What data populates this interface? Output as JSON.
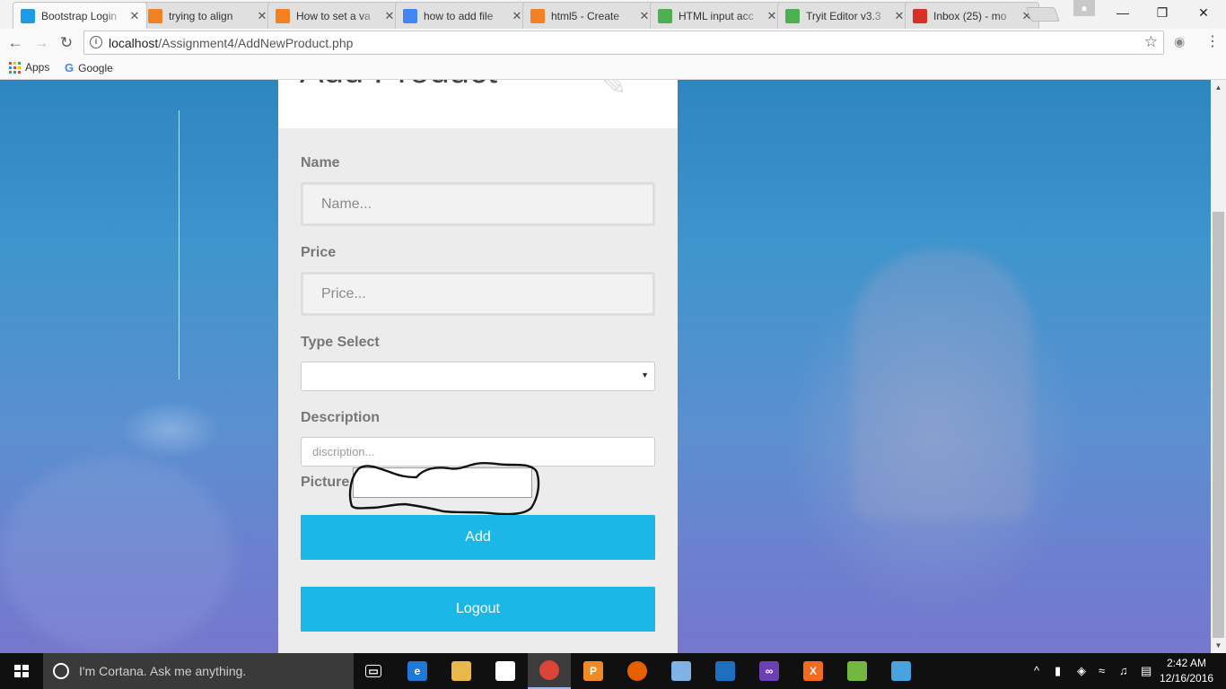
{
  "browser": {
    "tabs": [
      {
        "title": "Bootstrap Login",
        "icon": "bootstrap-login-favicon",
        "color": "#1e9be6",
        "active": true
      },
      {
        "title": "trying to align",
        "icon": "stackoverflow-favicon",
        "color": "#f48024",
        "active": false
      },
      {
        "title": "How to set a va",
        "icon": "stackoverflow-favicon",
        "color": "#f48024",
        "active": false
      },
      {
        "title": "how to add file",
        "icon": "google-favicon",
        "color": "#4285f4",
        "active": false
      },
      {
        "title": "html5 - Create",
        "icon": "stackoverflow-favicon",
        "color": "#f48024",
        "active": false
      },
      {
        "title": "HTML input acc",
        "icon": "w3schools-favicon",
        "color": "#4caf50",
        "active": false
      },
      {
        "title": "Tryit Editor v3.3",
        "icon": "w3schools-favicon",
        "color": "#4caf50",
        "active": false
      },
      {
        "title": "Inbox (25) - mo",
        "icon": "gmail-favicon",
        "color": "#d93025",
        "active": false
      }
    ],
    "url_host": "localhost",
    "url_path": "/Assignment4/AddNewProduct.php",
    "bookmarks": [
      {
        "label": "Apps",
        "icon": "apps-grid-icon"
      },
      {
        "label": "Google",
        "icon": "google-icon"
      }
    ]
  },
  "page": {
    "header_title": "Add Product",
    "name_label": "Name",
    "name_placeholder": "Name...",
    "price_label": "Price",
    "price_placeholder": "Price...",
    "type_label": "Type Select",
    "type_value": "",
    "description_label": "Description",
    "description_placeholder": "discription...",
    "picture_label": "Picture",
    "add_button": "Add",
    "logout_button": "Logout"
  },
  "taskbar": {
    "search_text": "I'm Cortana. Ask me anything.",
    "apps": [
      {
        "name": "task-view-icon",
        "color": "#101010",
        "glyph": "▭"
      },
      {
        "name": "edge-icon",
        "color": "#1e78d7",
        "glyph": "e"
      },
      {
        "name": "file-explorer-icon",
        "color": "#e8b84a",
        "glyph": ""
      },
      {
        "name": "store-icon",
        "color": "#ffffff",
        "glyph": ""
      },
      {
        "name": "chrome-icon",
        "color": "#db4437",
        "glyph": ""
      },
      {
        "name": "pdf-app-icon",
        "color": "#f08a24",
        "glyph": "P"
      },
      {
        "name": "firefox-icon",
        "color": "#e66000",
        "glyph": ""
      },
      {
        "name": "box-app-icon",
        "color": "#7fb2e5",
        "glyph": ""
      },
      {
        "name": "window-app-icon",
        "color": "#1f6fc0",
        "glyph": ""
      },
      {
        "name": "visual-studio-icon",
        "color": "#6c3fb4",
        "glyph": "∞"
      },
      {
        "name": "xampp-icon",
        "color": "#f26b21",
        "glyph": "X"
      },
      {
        "name": "notepad-plus-icon",
        "color": "#74b740",
        "glyph": ""
      },
      {
        "name": "paint-icon",
        "color": "#4aa3df",
        "glyph": ""
      }
    ],
    "time": "2:42 AM",
    "date": "12/16/2016"
  }
}
